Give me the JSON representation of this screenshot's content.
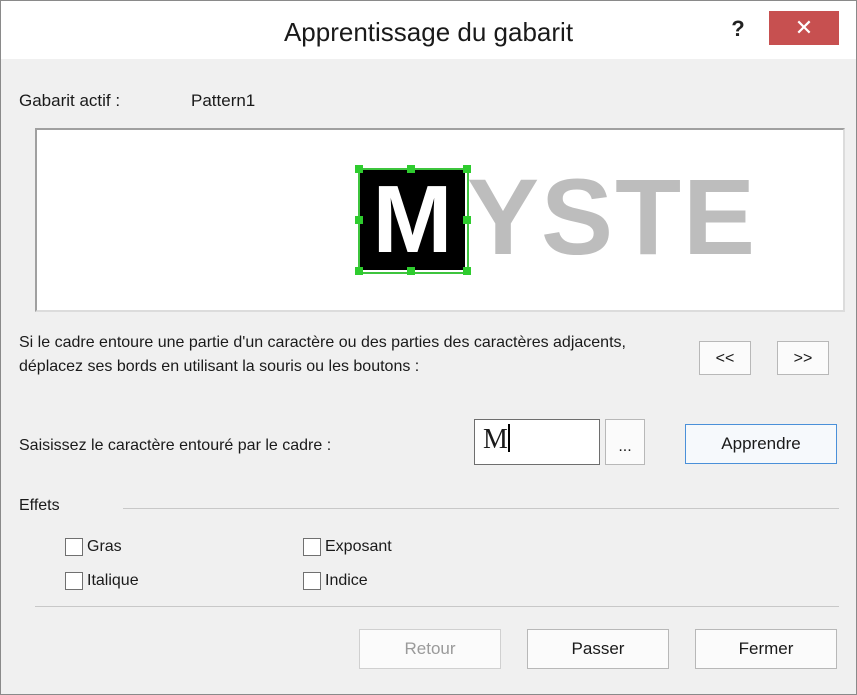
{
  "window": {
    "title": "Apprentissage du gabarit",
    "help_label": "?",
    "close_label": "✕"
  },
  "active_pattern": {
    "label": "Gabarit actif :",
    "value": "Pattern1"
  },
  "preview": {
    "selected_char": "M",
    "remaining_chars": "YSTE",
    "selection_color": "#3ec43e",
    "remaining_color": "#bdbdbd"
  },
  "instruction": "Si le cadre entoure une partie d'un caractère ou des parties des caractères adjacents, déplacez ses bords en utilisant la souris ou les boutons :",
  "nav": {
    "prev_label": "<<",
    "next_label": ">>"
  },
  "entry": {
    "label": "Saisissez le caractère entouré par le cadre :",
    "value": "M",
    "browse_label": "...",
    "learn_label": "Apprendre"
  },
  "effects": {
    "label": "Effets",
    "options": [
      {
        "label": "Gras",
        "checked": false
      },
      {
        "label": "Exposant",
        "checked": false
      },
      {
        "label": "Italique",
        "checked": false
      },
      {
        "label": "Indice",
        "checked": false
      }
    ]
  },
  "footer": {
    "back_label": "Retour",
    "skip_label": "Passer",
    "close_label": "Fermer"
  }
}
